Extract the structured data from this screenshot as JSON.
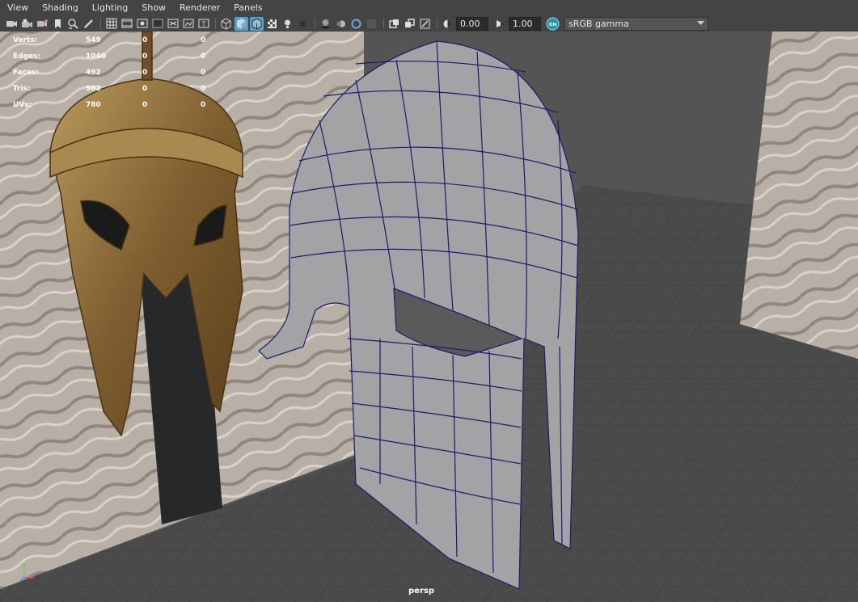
{
  "menubar": {
    "items": [
      "View",
      "Shading",
      "Lighting",
      "Show",
      "Renderer",
      "Panels"
    ]
  },
  "toolbar": {
    "gamma_value": "0.00",
    "exposure_value": "1.00",
    "color_space": "sRGB gamma",
    "icons": [
      "camera-select-icon",
      "camera-attributes-icon",
      "bookmarks-icon",
      "image-plane-icon",
      "2d-pan-zoom-icon",
      "grease-pencil-icon",
      "grid-icon",
      "film-gate-icon",
      "resolution-gate-icon",
      "gate-mask-icon",
      "field-chart-icon",
      "safe-action-icon",
      "safe-title-icon",
      "wireframe-icon",
      "smooth-shade-icon",
      "wireframe-on-shaded-icon",
      "textured-icon",
      "use-all-lights-icon",
      "shadows-icon",
      "ambient-occlusion-icon",
      "motion-blur-icon",
      "anti-aliasing-icon",
      "depth-of-field-icon",
      "isolate-select-icon",
      "xray-icon",
      "xray-joints-icon",
      "xray-components-icon",
      "exposure-icon",
      "gamma-icon",
      "color-management-icon"
    ]
  },
  "hud": {
    "rows": [
      {
        "label": "Verts:",
        "v1": "549",
        "v2": "0",
        "v3": "0"
      },
      {
        "label": "Edges:",
        "v1": "1040",
        "v2": "0",
        "v3": "0"
      },
      {
        "label": "Faces:",
        "v1": "492",
        "v2": "0",
        "v3": "0"
      },
      {
        "label": "Tris:",
        "v1": "982",
        "v2": "0",
        "v3": "0"
      },
      {
        "label": "UVs:",
        "v1": "780",
        "v2": "0",
        "v3": "0"
      }
    ]
  },
  "viewport": {
    "camera": "persp",
    "colors": {
      "background": "#545454",
      "grid_floor": "#4a4a4a",
      "grid_line": "#3a3a3a",
      "mesh_fill": "#a3a3a6",
      "mesh_wire": "#1a1a6e",
      "bronze": "#8a6a38",
      "stone": "#b5ada3",
      "accent_toolbar_active": "#5a9fc9"
    }
  }
}
